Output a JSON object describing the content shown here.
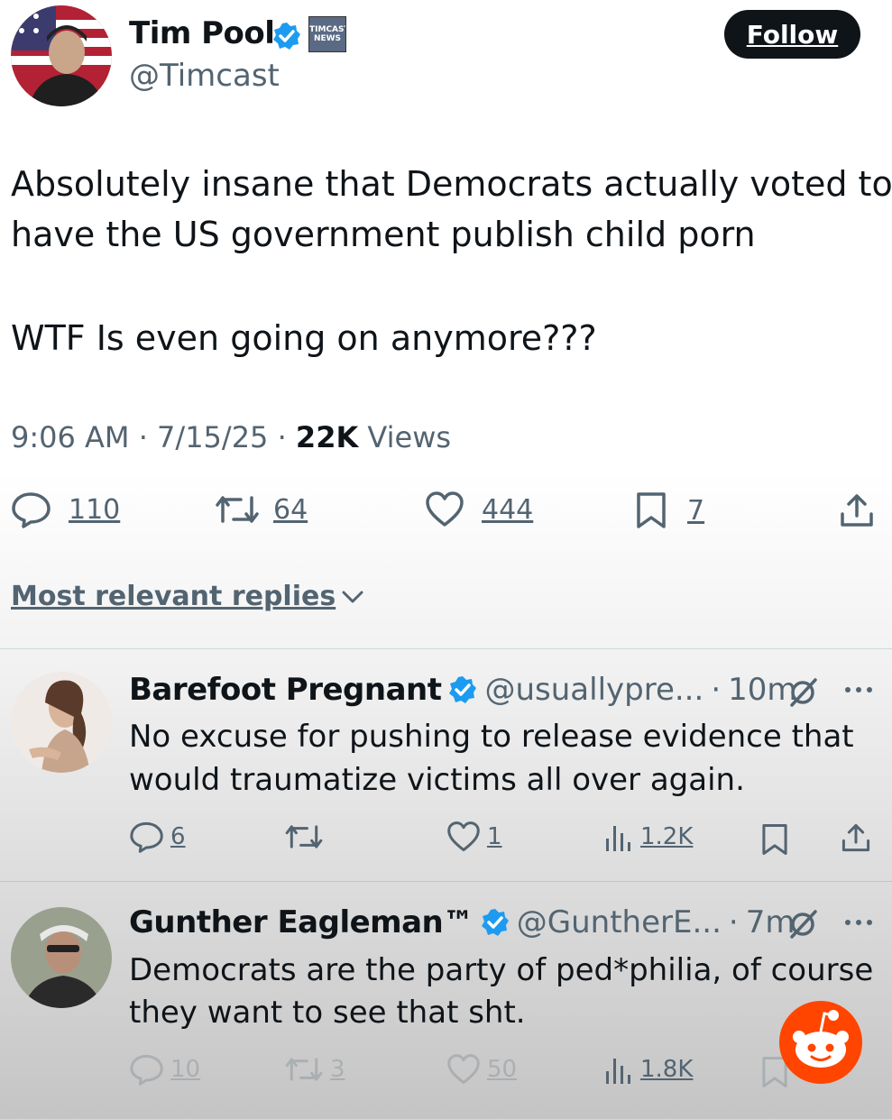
{
  "tweet": {
    "author_name": "Tim Pool",
    "author_handle": "@Timcast",
    "badge_text": "TIMCAST NEWS",
    "follow_label": "Follow",
    "text_line1": "Absolutely insane that Democrats actually voted to",
    "text_line2": "have the US government publish child porn",
    "text_line3": "WTF Is even going on anymore???",
    "time": "9:06 AM",
    "date": "7/15/25",
    "views_count": "22K",
    "views_label": "Views",
    "replies": "110",
    "reposts": "64",
    "likes": "444",
    "bookmarks": "7"
  },
  "sort": {
    "label": "Most relevant replies"
  },
  "replies": [
    {
      "name": "Barefoot Pregnant",
      "handle": "@usuallypre...",
      "time": "10m",
      "text_line1": "No excuse for pushing to release evidence that",
      "text_line2": "would traumatize victims all over again.",
      "replies": "6",
      "reposts": "",
      "likes": "1",
      "views": "1.2K"
    },
    {
      "name": "Gunther Eagleman™",
      "handle": "@GuntherE...",
      "time": "7m",
      "text_line1": "Democrats are the party of ped*philia, of course",
      "text_line2": "they want to see that sht.",
      "replies": "10",
      "reposts": "3",
      "likes": "50",
      "views": "1.8K"
    }
  ],
  "colors": {
    "verified": "#1d9bf0",
    "reddit": "#ff4500",
    "text_primary": "#0f1419",
    "text_secondary": "#536471"
  }
}
